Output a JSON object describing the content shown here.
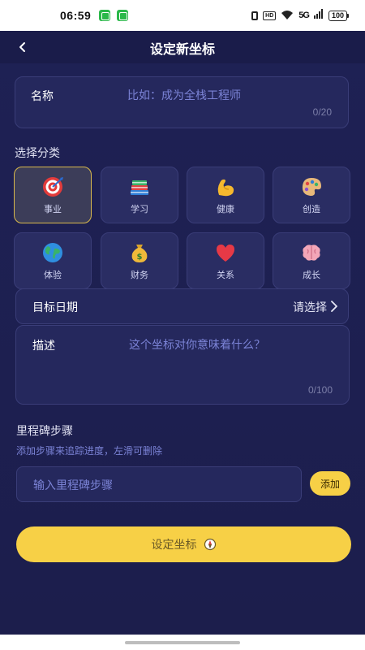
{
  "status_bar": {
    "time": "06:59",
    "battery": "100",
    "hd": "HD",
    "signal": "5G"
  },
  "header": {
    "title": "设定新坐标"
  },
  "name_field": {
    "label": "名称",
    "placeholder": "比如：成为全栈工程师",
    "counter": "0/20"
  },
  "categories_section": {
    "label": "选择分类"
  },
  "categories": [
    {
      "label": "事业",
      "icon": "target-icon",
      "selected": true
    },
    {
      "label": "学习",
      "icon": "books-icon",
      "selected": false
    },
    {
      "label": "健康",
      "icon": "muscle-icon",
      "selected": false
    },
    {
      "label": "创造",
      "icon": "palette-icon",
      "selected": false
    },
    {
      "label": "体验",
      "icon": "globe-icon",
      "selected": false
    },
    {
      "label": "财务",
      "icon": "money-bag-icon",
      "selected": false
    },
    {
      "label": "关系",
      "icon": "heart-icon",
      "selected": false
    },
    {
      "label": "成长",
      "icon": "brain-icon",
      "selected": false
    }
  ],
  "target_date": {
    "label": "目标日期",
    "value": "请选择"
  },
  "description": {
    "label": "描述",
    "placeholder": "这个坐标对你意味着什么？",
    "counter": "0/100"
  },
  "milestones": {
    "label": "里程碑步骤",
    "hint": "添加步骤来追踪进度，左滑可删除",
    "input_placeholder": "输入里程碑步骤",
    "add_label": "添加"
  },
  "submit": {
    "label": "设定坐标"
  },
  "colors": {
    "accent": "#f7d046",
    "background": "#1e2154",
    "card": "#25285d",
    "placeholder": "#7b83d6"
  }
}
